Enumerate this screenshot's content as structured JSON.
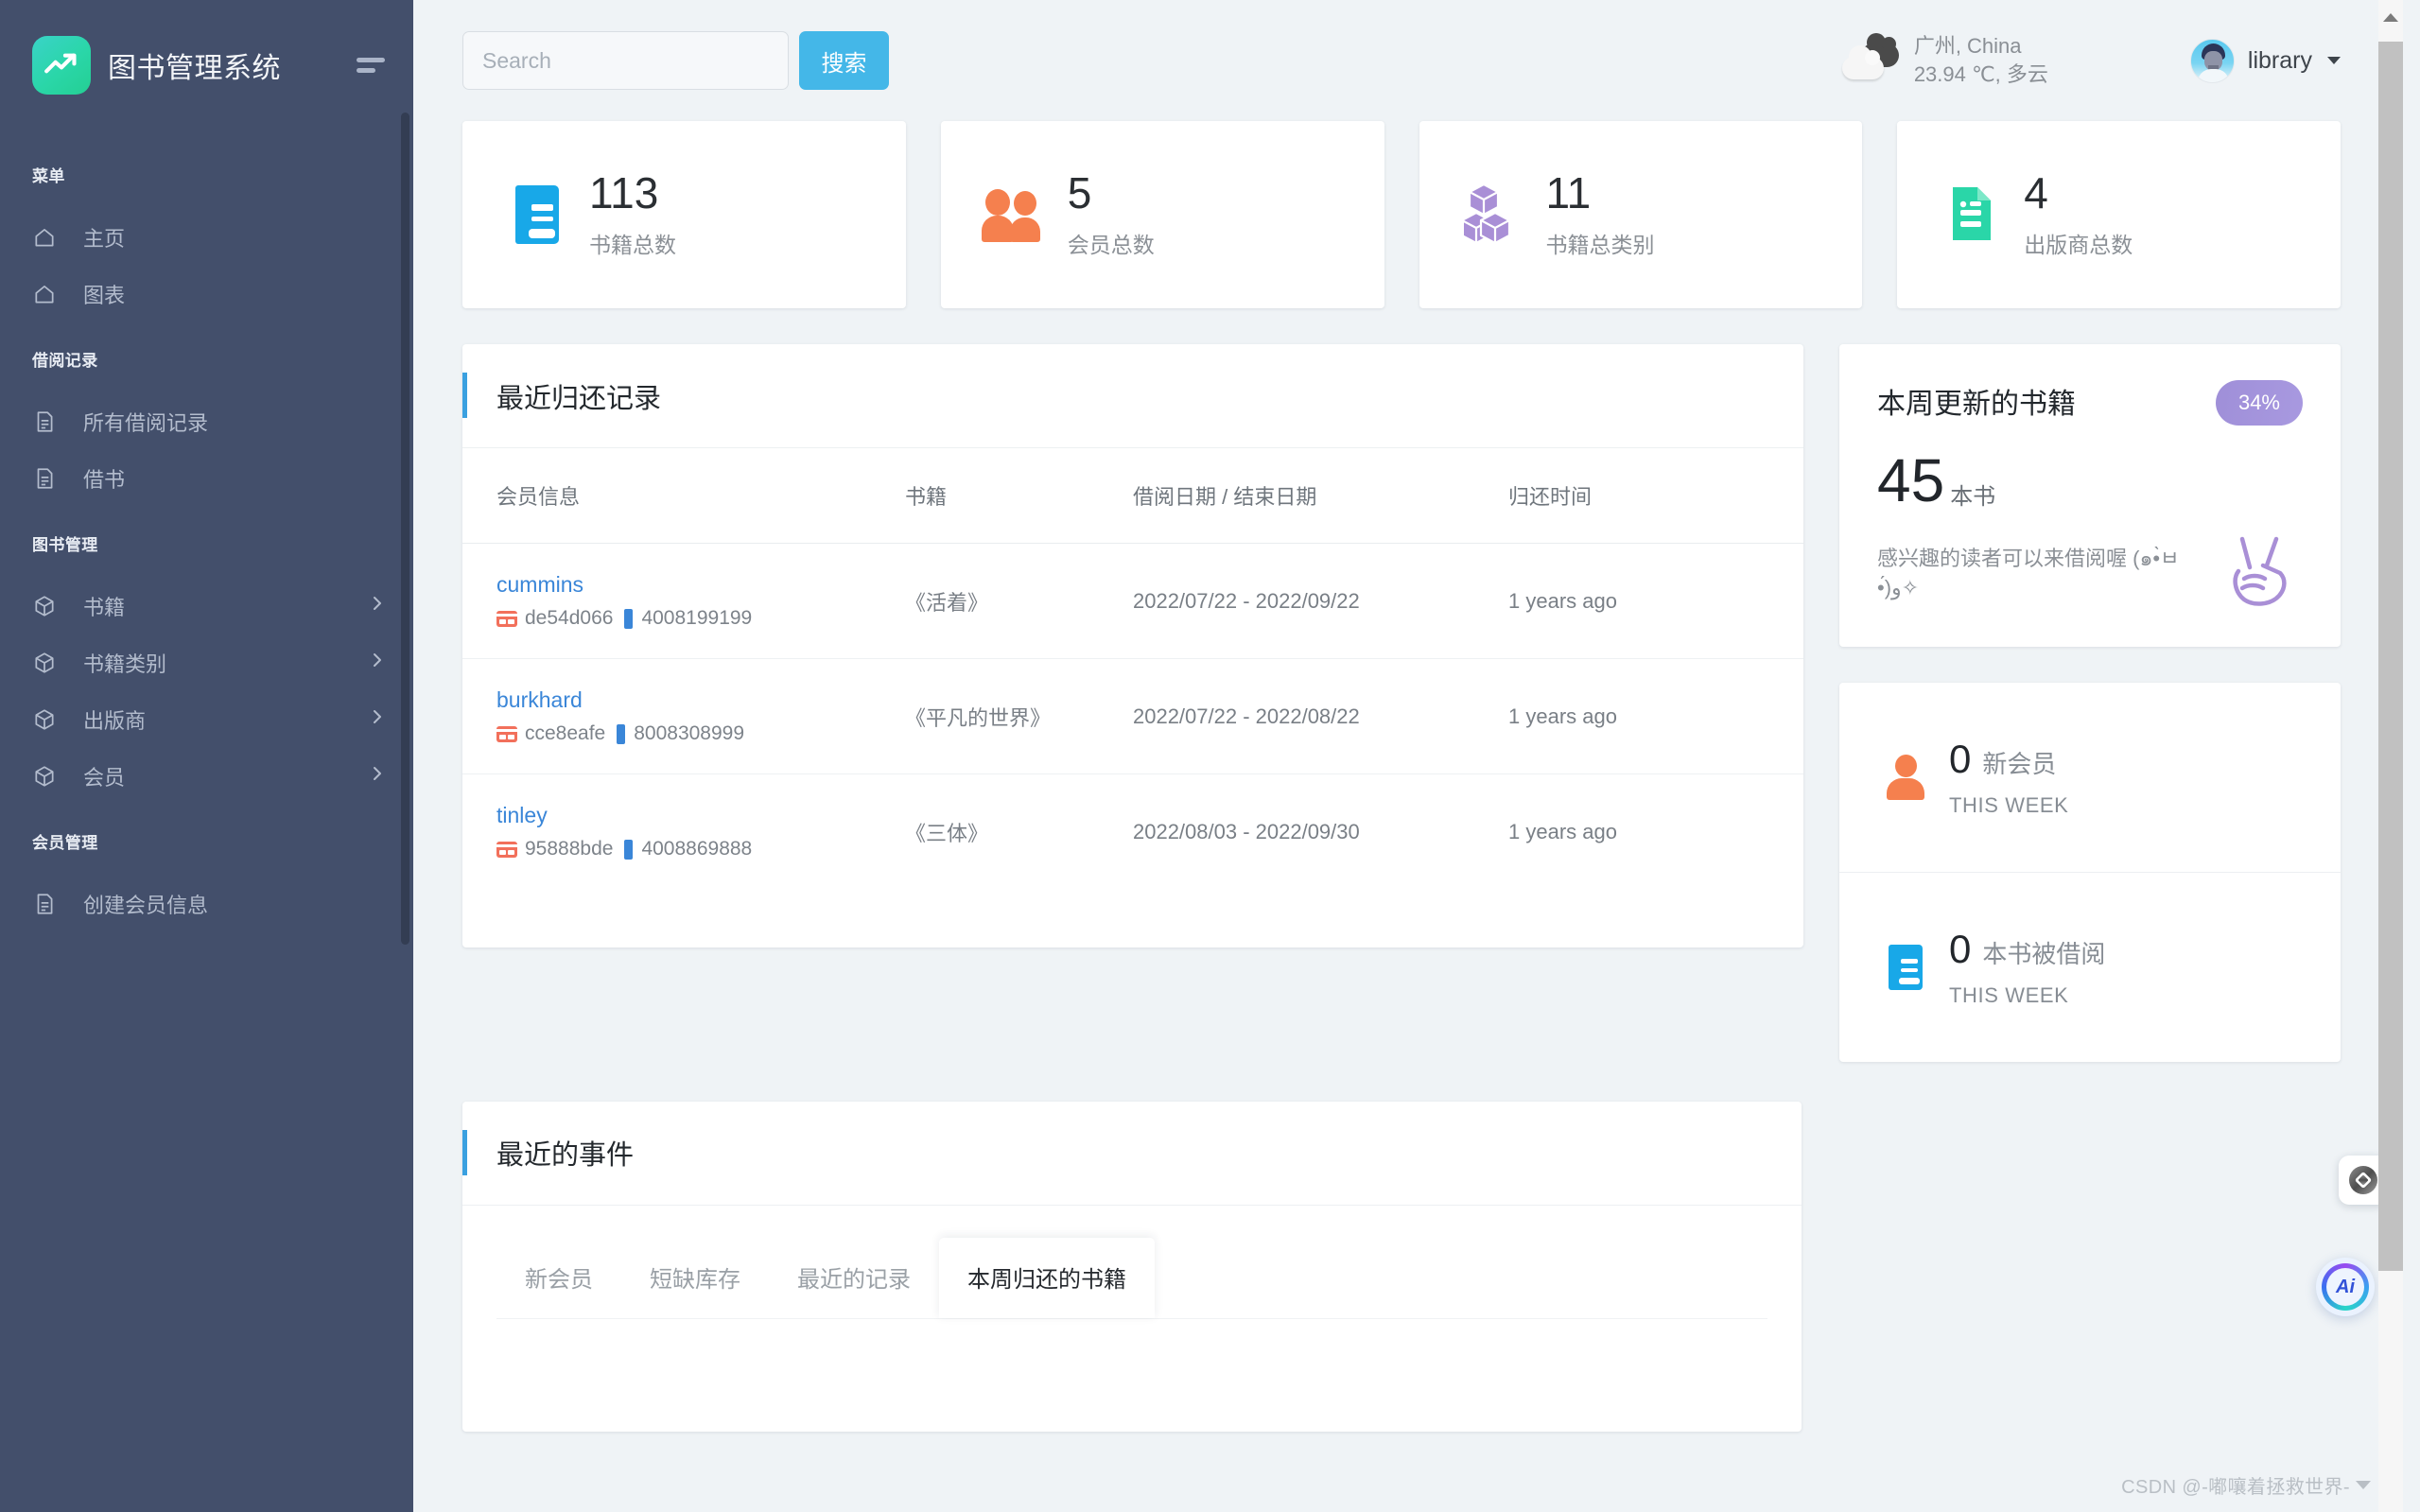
{
  "brand": {
    "title": "图书管理系统",
    "logo_icon": "trending-up-icon",
    "menu_toggle_icon": "hamburger-icon"
  },
  "sidebar": {
    "groups": [
      {
        "label": "菜单",
        "items": [
          {
            "label": "主页",
            "icon": "home-icon",
            "chevron": false
          },
          {
            "label": "图表",
            "icon": "home-icon",
            "chevron": false
          }
        ]
      },
      {
        "label": "借阅记录",
        "items": [
          {
            "label": "所有借阅记录",
            "icon": "document-icon",
            "chevron": false
          },
          {
            "label": "借书",
            "icon": "document-icon",
            "chevron": false
          }
        ]
      },
      {
        "label": "图书管理",
        "items": [
          {
            "label": "书籍",
            "icon": "box-icon",
            "chevron": true
          },
          {
            "label": "书籍类别",
            "icon": "box-icon",
            "chevron": true
          },
          {
            "label": "出版商",
            "icon": "box-icon",
            "chevron": true
          },
          {
            "label": "会员",
            "icon": "box-icon",
            "chevron": true
          }
        ]
      },
      {
        "label": "会员管理",
        "items": [
          {
            "label": "创建会员信息",
            "icon": "document-icon",
            "chevron": false
          }
        ]
      }
    ]
  },
  "topbar": {
    "search_placeholder": "Search",
    "search_value": "",
    "search_button": "搜索",
    "weather": {
      "icon": "partly-cloudy-icon",
      "location": "广州, China",
      "condition": "23.94 ℃, 多云"
    },
    "user": {
      "name": "library",
      "avatar_icon": "user-avatar",
      "caret_icon": "caret-down-icon"
    }
  },
  "stats": [
    {
      "value": "113",
      "label": "书籍总数",
      "icon": "book-icon",
      "color": "#18a8e8"
    },
    {
      "value": "5",
      "label": "会员总数",
      "icon": "people-icon",
      "color": "#f5804e"
    },
    {
      "value": "11",
      "label": "书籍总类别",
      "icon": "boxes-icon",
      "color": "#a98fd6"
    },
    {
      "value": "4",
      "label": "出版商总数",
      "icon": "document-icon",
      "color": "#2ad6a8"
    }
  ],
  "returns_panel": {
    "title": "最近归还记录",
    "columns": [
      "会员信息",
      "书籍",
      "借阅日期 / 结束日期",
      "归还时间"
    ],
    "rows": [
      {
        "name": "cummins",
        "card": "de54d066",
        "phone": "4008199199",
        "book": "《活着》",
        "period": "2022/07/22 - 2022/09/22",
        "returned": "1 years ago"
      },
      {
        "name": "burkhard",
        "card": "cce8eafe",
        "phone": "8008308999",
        "book": "《平凡的世界》",
        "period": "2022/07/22 - 2022/08/22",
        "returned": "1 years ago"
      },
      {
        "name": "tinley",
        "card": "95888bde",
        "phone": "4008869888",
        "book": "《三体》",
        "period": "2022/08/03 - 2022/09/30",
        "returned": "1 years ago"
      }
    ]
  },
  "week_card": {
    "title": "本周更新的书籍",
    "badge": "34%",
    "number": "45",
    "unit": "本书",
    "subtitle": "感兴趣的读者可以来借阅喔 (๑•̀ㅂ•́)و✧",
    "decor_icon": "peace-hand-icon",
    "accent": "#a899e0"
  },
  "mini_cards": [
    {
      "number": "0",
      "label": "新会员",
      "sub": "THIS WEEK",
      "icon": "person-icon",
      "color": "#f5804e"
    },
    {
      "number": "0",
      "label": "本书被借阅",
      "sub": "THIS WEEK",
      "icon": "book-icon",
      "color": "#18a8e8"
    }
  ],
  "events_panel": {
    "title": "最近的事件",
    "tabs": [
      {
        "label": "新会员",
        "active": false
      },
      {
        "label": "短缺库存",
        "active": false
      },
      {
        "label": "最近的记录",
        "active": false
      },
      {
        "label": "本周归还的书籍",
        "active": true
      }
    ]
  },
  "floating": {
    "dock_icon": "diamond-logo-icon",
    "ai_icon": "ai-assistant-icon",
    "ai_label": "Ai"
  },
  "watermark": {
    "text": "CSDN @-嘟嚷着拯救世界-"
  }
}
